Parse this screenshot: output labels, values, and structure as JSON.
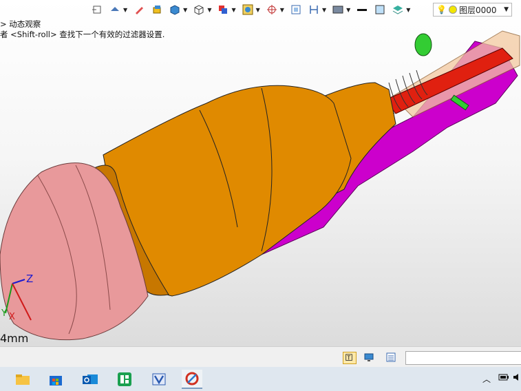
{
  "viewport": {
    "hint_line1": "> 动态观察",
    "hint_line2": "者 <Shift-roll> 查找下一个有效的过滤器设置.",
    "scale_text": "4mm",
    "axes": {
      "z": "Z",
      "y": "Y",
      "x": "X"
    }
  },
  "toolbar": {
    "items": [
      "select-icon",
      "view-icon",
      "pen-icon",
      "part-icon",
      "box-icon",
      "wireframe-icon",
      "color-icon",
      "target-icon",
      "measure-icon",
      "section-icon",
      "dimension-icon",
      "render-icon",
      "line-icon",
      "fill-icon",
      "layer-stack-icon"
    ],
    "layer": {
      "name": "图层0000",
      "color": "#f2e600"
    }
  },
  "statusbar": {
    "input_value": ""
  },
  "taskbar": {
    "apps": [
      "file-explorer-icon",
      "store-icon",
      "outlook-icon",
      "app-green-icon",
      "vs-icon",
      "cad-app-icon"
    ]
  },
  "colors": {
    "orange": "#e08a00",
    "pink": "#e8999b",
    "magenta": "#cc00cc",
    "red": "#e02010",
    "green": "#33cc33"
  }
}
